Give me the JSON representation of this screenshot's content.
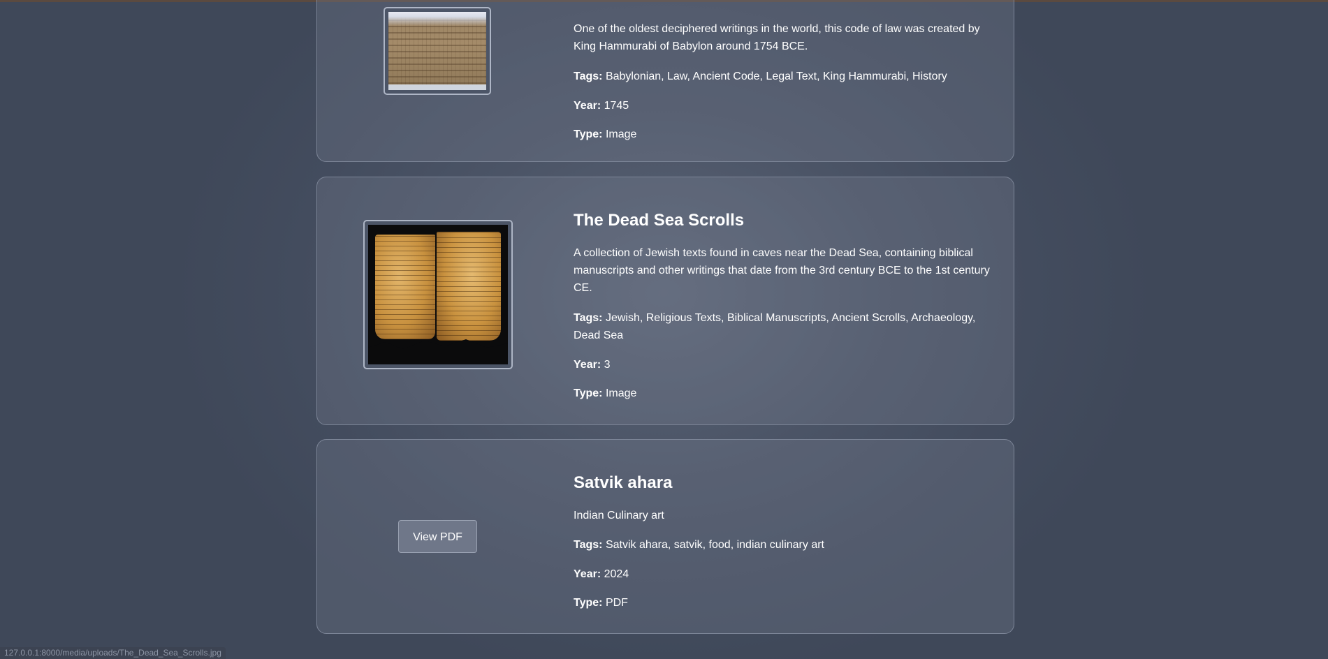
{
  "labels": {
    "tags": "Tags:",
    "year": "Year:",
    "type": "Type:"
  },
  "items": [
    {
      "title": "",
      "description": "One of the oldest deciphered writings in the world, this code of law was created by King Hammurabi of Babylon around 1754 BCE.",
      "tags": "Babylonian, Law, Ancient Code, Legal Text, King Hammurabi, History",
      "year": "1745",
      "type": "Image",
      "thumbnail_icon": "clay-tablet-image"
    },
    {
      "title": "The Dead Sea Scrolls",
      "description": "A collection of Jewish texts found in caves near the Dead Sea, containing biblical manuscripts and other writings that date from the 3rd century BCE to the 1st century CE.",
      "tags": "Jewish, Religious Texts, Biblical Manuscripts, Ancient Scrolls, Archaeology, Dead Sea",
      "year": "3",
      "type": "Image",
      "thumbnail_icon": "scroll-image"
    },
    {
      "title": "Satvik ahara",
      "description": "Indian Culinary art",
      "tags": "Satvik ahara, satvik, food, indian culinary art",
      "year": "2024",
      "type": "PDF",
      "button_label": "View PDF"
    }
  ],
  "status_bar": {
    "url": "127.0.0.1:8000/media/uploads/The_Dead_Sea_Scrolls.jpg"
  },
  "colors": {
    "background": "#4b5466",
    "card_border": "#7c8597",
    "text": "#ffffff"
  }
}
